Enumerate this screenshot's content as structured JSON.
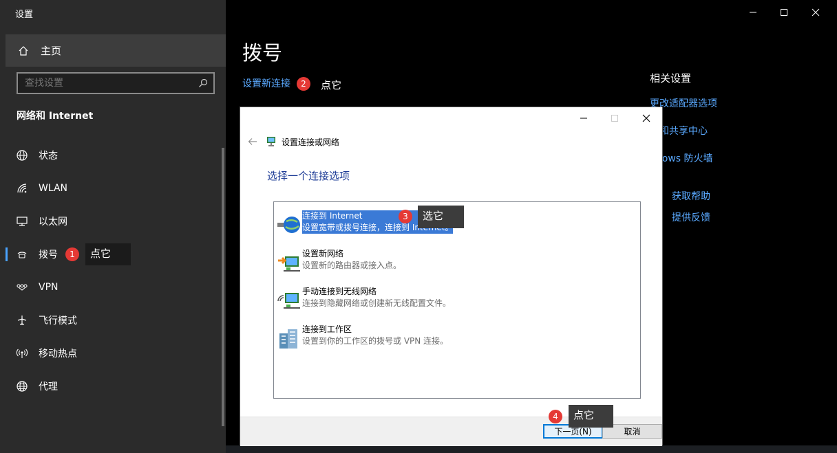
{
  "app": {
    "title": "设置"
  },
  "sidebar": {
    "home_label": "主页",
    "search_placeholder": "查找设置",
    "section_title": "网络和 Internet",
    "items": [
      {
        "label": "状态",
        "icon": "globe-status-icon"
      },
      {
        "label": "WLAN",
        "icon": "wifi-icon"
      },
      {
        "label": "以太网",
        "icon": "ethernet-icon"
      },
      {
        "label": "拨号",
        "icon": "dialup-icon",
        "active": true
      },
      {
        "label": "VPN",
        "icon": "vpn-icon"
      },
      {
        "label": "飞行模式",
        "icon": "airplane-icon"
      },
      {
        "label": "移动热点",
        "icon": "hotspot-icon"
      },
      {
        "label": "代理",
        "icon": "globe-icon"
      }
    ]
  },
  "main": {
    "title": "拨号",
    "new_connection_link": "设置新连接",
    "related": {
      "heading": "相关设置",
      "links": [
        "更改适配器选项",
        "络和共享中心",
        "ndows 防火墙"
      ],
      "help": "获取帮助",
      "feedback": "提供反馈"
    }
  },
  "dialog": {
    "title": "设置连接或网络",
    "heading": "选择一个连接选项",
    "options": [
      {
        "title": "连接到 Internet",
        "desc": "设置宽带或拨号连接，连接到 Internet。",
        "selected": true
      },
      {
        "title": "设置新网络",
        "desc": "设置新的路由器或接入点。"
      },
      {
        "title": "手动连接到无线网络",
        "desc": "连接到隐藏网络或创建新无线配置文件。"
      },
      {
        "title": "连接到工作区",
        "desc": "设置到你的工作区的拨号或 VPN 连接。"
      }
    ],
    "next_button": "下一页(N)",
    "cancel_button": "取消"
  },
  "annotations": {
    "step1": {
      "num": "1",
      "text": "点它"
    },
    "step2": {
      "num": "2",
      "text": "点它"
    },
    "step3": {
      "num": "3",
      "text": "选它"
    },
    "step4": {
      "num": "4",
      "text": "点它"
    }
  },
  "colors": {
    "accent": "#4aa3ff",
    "link": "#5aa9ff",
    "badge": "#e53935",
    "selection": "#3b7ad6",
    "dialog_heading": "#1e3c96"
  }
}
